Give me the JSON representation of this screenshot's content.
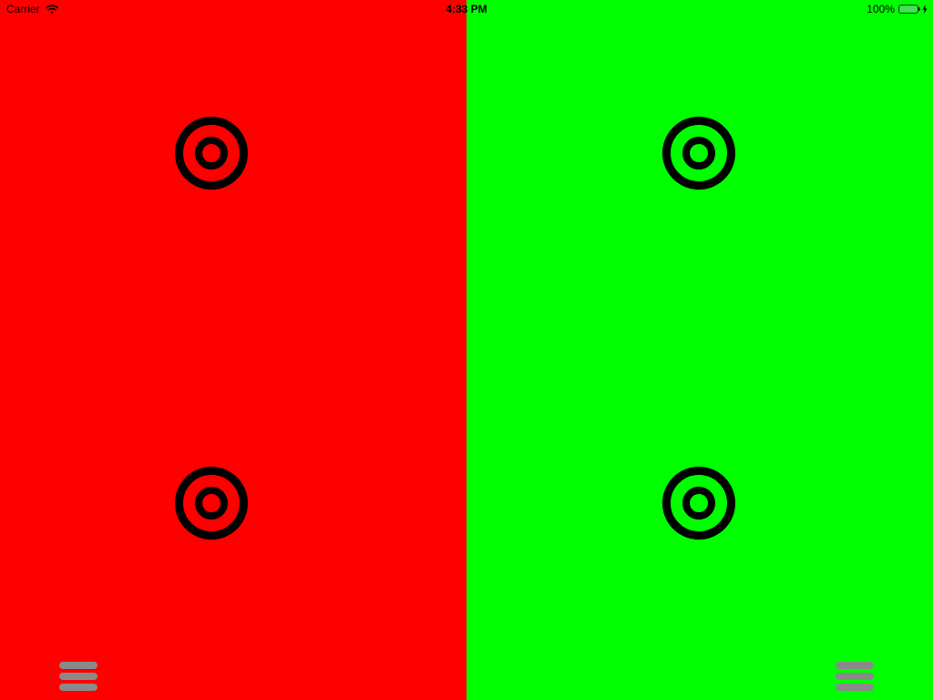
{
  "status_bar": {
    "carrier": "Carrier",
    "time": "4:33 PM",
    "battery_percent": "100%",
    "battery_level": 1.0,
    "wifi_icon": "wifi-icon",
    "charging_icon": "bolt-icon"
  },
  "panels": {
    "left": {
      "color": "#ff0000"
    },
    "right": {
      "color": "#00ff00"
    }
  },
  "targets": [
    {
      "icon": "target-icon"
    },
    {
      "icon": "target-icon"
    },
    {
      "icon": "target-icon"
    },
    {
      "icon": "target-icon"
    }
  ],
  "menu_buttons": {
    "left": {
      "icon": "hamburger-menu-icon",
      "color": "#8a8a8a"
    },
    "right": {
      "icon": "hamburger-menu-icon",
      "color": "#8a8a8a"
    }
  },
  "colors": {
    "target_stroke": "#000000",
    "battery_fill": "#4cd964"
  }
}
